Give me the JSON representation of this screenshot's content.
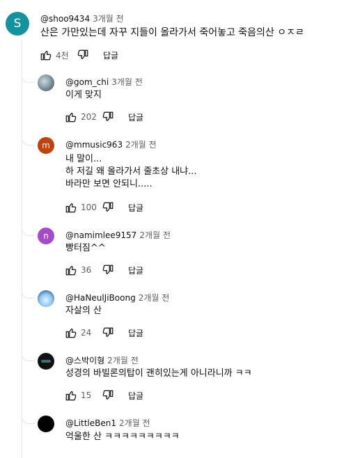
{
  "comments": [
    {
      "author": "@shoo9434",
      "time": "3개월 전",
      "text": "산은 가만있는데 자꾸 지들이 올라가서 죽어놓고 죽음의산 ㅇㅈㄹ",
      "likes": "4천",
      "reply": "답글",
      "avatar_letter": "S",
      "avatar_color": "#13939f"
    },
    {
      "author": "@gom_chi",
      "time": "3개월 전",
      "text": "이게 맞지",
      "likes": "202",
      "reply": "답글"
    },
    {
      "author": "@mmusic963",
      "time": "2개월 전",
      "text": "내 말이...\n하 저길 왜 올라가서 줄초상 내냐...\n바라만 보면 안되니.....",
      "likes": "100",
      "reply": "답글",
      "avatar_letter": "m",
      "avatar_color": "#c2410c"
    },
    {
      "author": "@namimlee9157",
      "time": "2개월 전",
      "text": "빵터짐^^",
      "likes": "36",
      "reply": "답글",
      "avatar_letter": "n",
      "avatar_color": "#a34bc9"
    },
    {
      "author": "@HaNeulJiBoong",
      "time": "2개월 전",
      "text": "자살의 산",
      "likes": "24",
      "reply": "답글"
    },
    {
      "author": "@스박이형",
      "time": "2개월 전",
      "text": "성경의 바빌론의탑이 괜히있는게 아니라니까 ㅋㅋ",
      "likes": "15",
      "reply": "답글"
    },
    {
      "author": "@LittleBen1",
      "time": "2개월 전",
      "text": "억울한 산 ㅋㅋㅋㅋㅋㅋㅋㅋㅋ"
    }
  ],
  "icons": {
    "like": "thumb-up-icon",
    "dislike": "thumb-down-icon"
  }
}
